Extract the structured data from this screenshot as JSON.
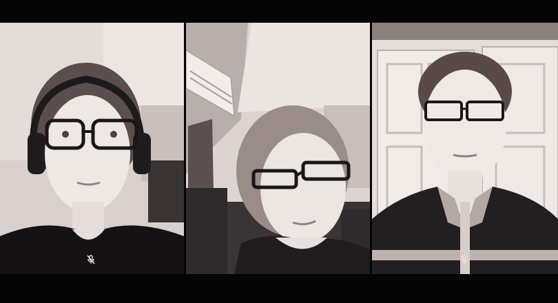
{
  "meeting": {
    "participants": [
      {
        "id": "participant-1",
        "mic": "muted",
        "icon": "mic-off-icon"
      },
      {
        "id": "participant-2",
        "mic": "on"
      },
      {
        "id": "participant-3",
        "mic": "muted",
        "icon": "mic-off-icon"
      }
    ]
  },
  "colors": {
    "background": "#050505",
    "tint_light": "#e2d9d6",
    "tint_mid": "#a99f9d",
    "tint_dark": "#1e1b1c"
  }
}
